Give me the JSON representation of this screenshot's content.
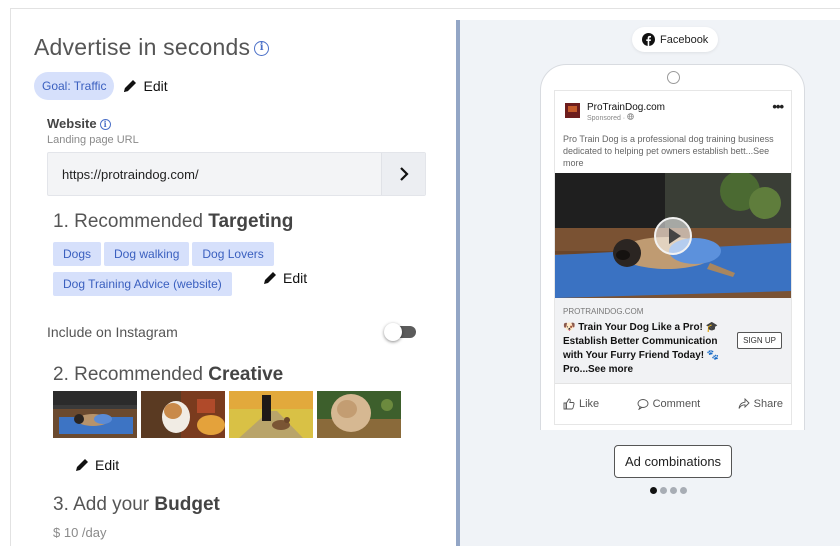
{
  "left": {
    "title": "Advertise in seconds",
    "goal_chip": "Goal: Traffic",
    "edit_label": "Edit",
    "website": {
      "label": "Website",
      "sublabel": "Landing page URL",
      "url": "https://protraindog.com/"
    },
    "targeting": {
      "prefix": "1. Recommended ",
      "emphasis": "Targeting",
      "tags": [
        "Dogs",
        "Dog walking",
        "Dog Lovers",
        "Dog Training Advice (website)"
      ]
    },
    "instagram": {
      "label": "Include on Instagram",
      "enabled": false
    },
    "creative": {
      "prefix": "2. Recommended ",
      "emphasis": "Creative",
      "thumbnails": [
        "pug-on-yoga-mat",
        "dog-with-treat",
        "dog-walking-path",
        "fluffy-dog"
      ]
    },
    "budget": {
      "prefix": "3. Add your ",
      "emphasis": "Budget",
      "amount": "$ 10 /day"
    }
  },
  "preview": {
    "platform": "Facebook",
    "page_name": "ProTrainDog.com",
    "sponsored": "Sponsored · ",
    "more_icon": "ellipsis-icon",
    "text": "Pro Train Dog is a professional dog training business dedicated to helping pet owners establish bett...See more",
    "domain": "PROTRAINDOG.COM",
    "headline": "🐶 Train Your Dog Like a Pro! 🎓 Establish Better Communication with Your Furry Friend Today! 🐾 Pro...See more",
    "cta": "SIGN UP",
    "actions": {
      "like": "Like",
      "comment": "Comment",
      "share": "Share"
    },
    "ad_combinations": "Ad combinations",
    "carousel": {
      "total": 4,
      "active": 1
    }
  },
  "colors": {
    "accent": "#3a5fbf",
    "chip_bg": "#d6e0fb",
    "divider": "#93a6c6",
    "preview_bg": "#f0f3f7",
    "facebook": "#1877f2"
  }
}
